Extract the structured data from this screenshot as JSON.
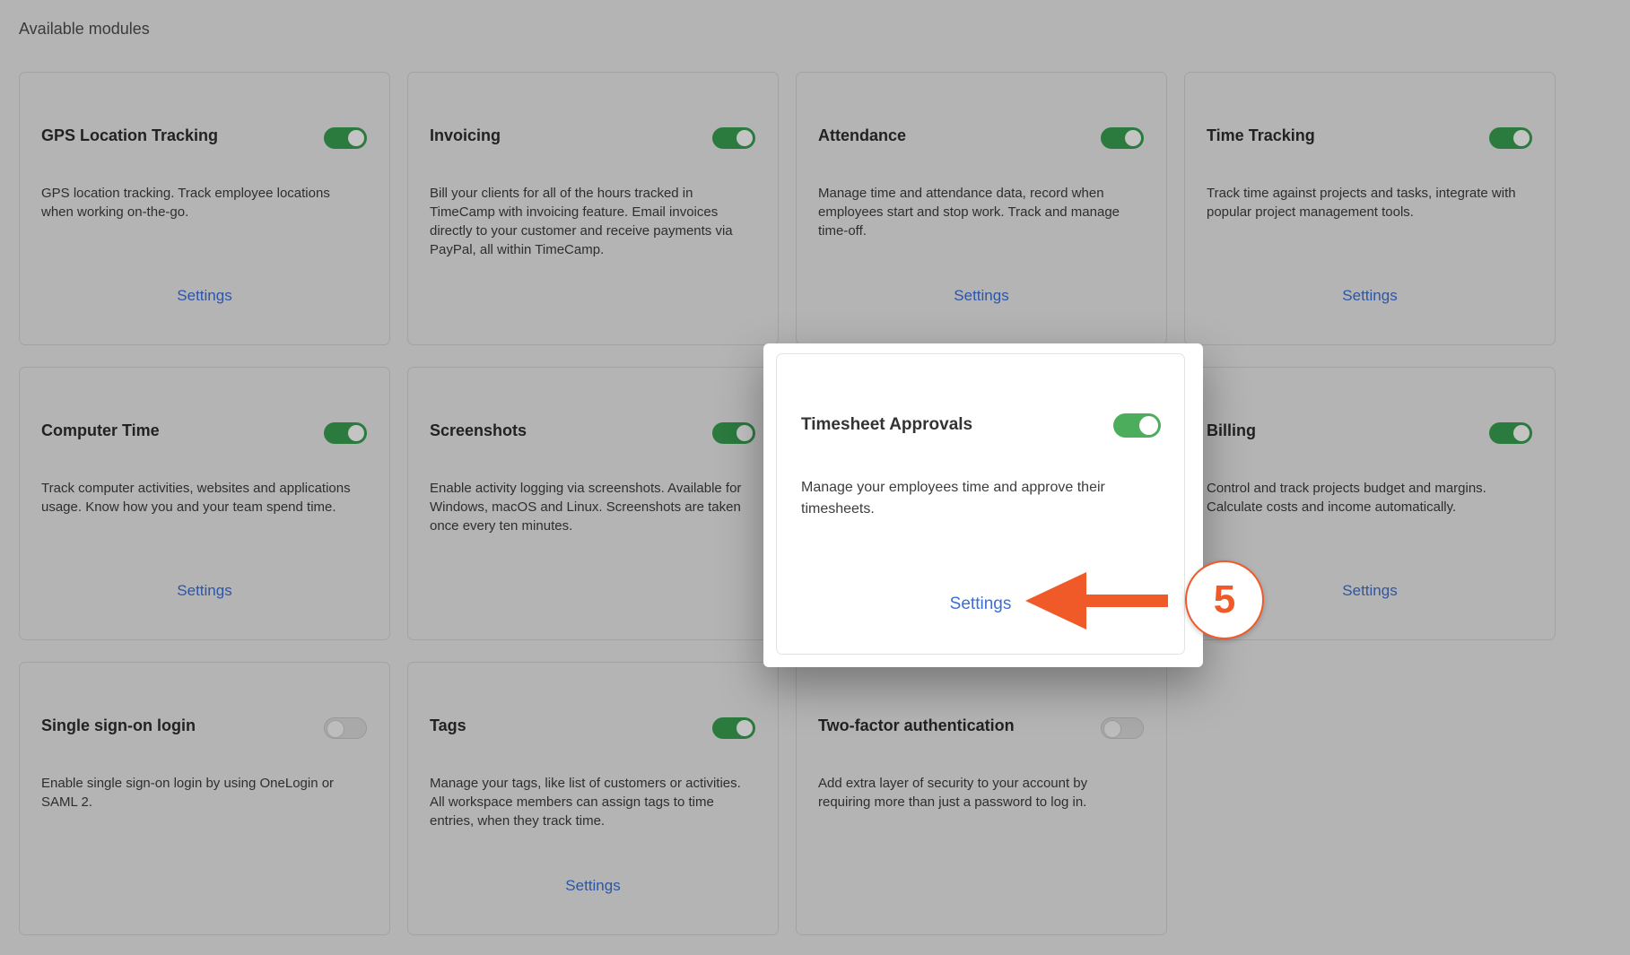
{
  "page": {
    "title": "Available modules"
  },
  "modules": [
    {
      "title": "GPS Location Tracking",
      "description": "GPS location tracking. Track employee locations when working on-the-go.",
      "enabled": true,
      "settings_label": "Settings"
    },
    {
      "title": "Invoicing",
      "description": "Bill your clients for all of the hours tracked in TimeCamp with invoicing feature. Email invoices directly to your customer and receive payments via PayPal, all within TimeCamp.",
      "enabled": true,
      "settings_label": ""
    },
    {
      "title": "Attendance",
      "description": "Manage time and attendance data, record when employees start and stop work. Track and manage time-off.",
      "enabled": true,
      "settings_label": "Settings"
    },
    {
      "title": "Time Tracking",
      "description": "Track time against projects and tasks, integrate with popular project management tools.",
      "enabled": true,
      "settings_label": "Settings"
    },
    {
      "title": "Computer Time",
      "description": "Track computer activities, websites and applications usage. Know how you and your team spend time.",
      "enabled": true,
      "settings_label": "Settings"
    },
    {
      "title": "Screenshots",
      "description": "Enable activity logging via screenshots. Available for Windows, macOS and Linux. Screenshots are taken once every ten minutes.",
      "enabled": true,
      "settings_label": ""
    },
    {
      "title": "Billing",
      "description": "Control and track projects budget and margins. Calculate costs and income automatically.",
      "enabled": true,
      "settings_label": "Settings"
    },
    {
      "title": "Single sign-on login",
      "description": "Enable single sign-on login by using OneLogin or SAML 2.",
      "enabled": false,
      "settings_label": ""
    },
    {
      "title": "Tags",
      "description": "Manage your tags, like list of customers or activities. All workspace members can assign tags to time entries, when they track time.",
      "enabled": true,
      "settings_label": "Settings"
    },
    {
      "title": "Two-factor authentication",
      "description": "Add extra layer of security to your account by requiring more than just a password to log in.",
      "enabled": false,
      "settings_label": ""
    }
  ],
  "highlighted_module": {
    "title": "Timesheet Approvals",
    "description": "Manage your employees time and approve their timesheets.",
    "enabled": true,
    "settings_label": "Settings"
  },
  "annotation": {
    "step_number": "5",
    "color": "#f05a28"
  },
  "colors": {
    "toggle_on": "#2b7a3e",
    "toggle_on_highlight": "#4cae5c",
    "link": "#2d55a6",
    "link_highlight": "#3b6fd6"
  }
}
